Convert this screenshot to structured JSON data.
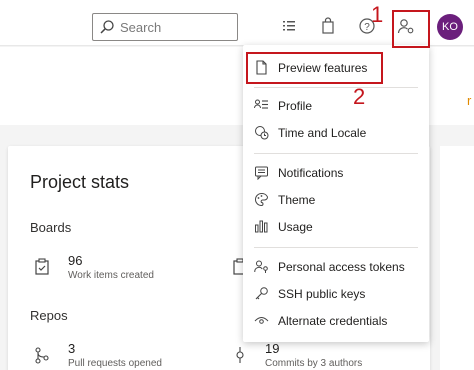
{
  "header": {
    "search": {
      "placeholder": "Search"
    },
    "icons": [
      "list-icon",
      "shopping-bag-icon",
      "help-icon",
      "user-settings-icon"
    ],
    "avatar_initials": "KO"
  },
  "callouts": {
    "one": "1",
    "two": "2",
    "color": "#c5161d"
  },
  "menu": {
    "items": [
      {
        "label": "Preview features",
        "icon": "document-icon"
      },
      {
        "label": "Profile",
        "icon": "profile-icon"
      },
      {
        "label": "Time and Locale",
        "icon": "globe-clock-icon"
      },
      {
        "label": "Notifications",
        "icon": "notification-icon"
      },
      {
        "label": "Theme",
        "icon": "palette-icon"
      },
      {
        "label": "Usage",
        "icon": "usage-icon"
      },
      {
        "label": "Personal access tokens",
        "icon": "token-icon"
      },
      {
        "label": "SSH public keys",
        "icon": "key-icon"
      },
      {
        "label": "Alternate credentials",
        "icon": "eye-icon"
      }
    ]
  },
  "stats": {
    "title": "Project stats",
    "boards": {
      "label": "Boards",
      "items": [
        {
          "value": "96",
          "caption": "Work items created",
          "icon": "work-item-icon"
        }
      ]
    },
    "repos": {
      "label": "Repos",
      "items": [
        {
          "value": "3",
          "caption": "Pull requests opened",
          "icon": "pull-request-icon"
        },
        {
          "value": "19",
          "caption": "Commits by 3 authors",
          "icon": "commit-icon"
        }
      ]
    }
  }
}
